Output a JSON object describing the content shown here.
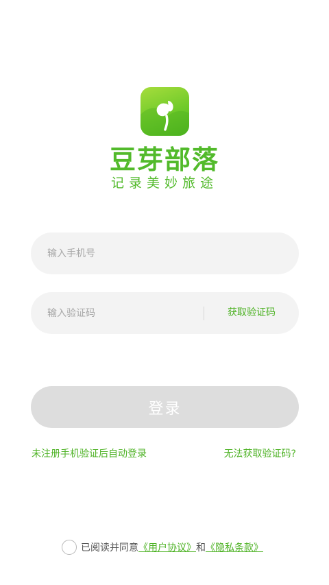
{
  "brand": {
    "app_icon": "sprout-logo-icon",
    "title": "豆芽部落",
    "slogan": "记录美妙旅途"
  },
  "form": {
    "phone_placeholder": "输入手机号",
    "code_placeholder": "输入验证码",
    "get_code_label": "获取验证码",
    "login_label": "登录"
  },
  "hints": {
    "auto_register": "未注册手机验证后自动登录",
    "cannot_get_code": "无法获取验证码?"
  },
  "agreement": {
    "prefix": "已阅读并同意",
    "user_agreement": "《用户协议》",
    "and": "和",
    "privacy_policy": "《隐私条款》"
  },
  "colors": {
    "accent": "#52ba2b",
    "field_bg": "#f3f3f3",
    "button_disabled": "#dddddd"
  }
}
